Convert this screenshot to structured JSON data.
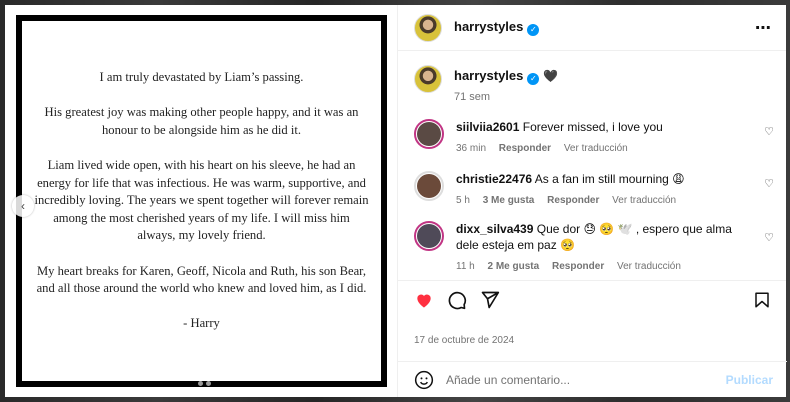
{
  "post": {
    "author": "harrystyles",
    "letter": {
      "paragraphs": [
        "I am truly devastated by Liam’s passing.",
        "His greatest joy was making other people happy, and it was an honour to be alongside him as he did it.",
        "Liam lived wide open, with his heart on his sleeve, he had an energy for life that was infectious. He was warm, supportive, and incredibly loving. The years we spent together will forever remain among the most cherished years of my life. I will miss him always, my lovely friend.",
        "My heart breaks for Karen, Geoff, Nicola and Ruth, his son Bear, and all those around the world who knew and loved him, as I did.",
        "- Harry"
      ]
    },
    "caption": {
      "author": "harrystyles",
      "time": "71 sem"
    },
    "comments": [
      {
        "user": "siilviia2601",
        "text": "Forever missed, i love you",
        "time": "36 min",
        "likes": "",
        "reply": "Responder",
        "translate": "Ver traducción"
      },
      {
        "user": "christie22476",
        "text": "As a fan im still mourning 😩",
        "time": "5 h",
        "likes": "3 Me gusta",
        "reply": "Responder",
        "translate": "Ver traducción"
      },
      {
        "user": "dixx_silva439",
        "text": "Que dor 😓 🥺 🕊️ , espero que alma dele esteja em paz 🥺",
        "time": "11 h",
        "likes": "2 Me gusta",
        "reply": "Responder",
        "translate": "Ver traducción"
      }
    ],
    "date": "17 de octubre de 2024",
    "add_comment": {
      "placeholder": "Añade un comentario...",
      "publish": "Publicar"
    },
    "more_icon": "⋯",
    "colors": {
      "like_red": "#ff3040",
      "verified_blue": "#0095f6",
      "publish_disabled": "#b3dbff"
    }
  }
}
